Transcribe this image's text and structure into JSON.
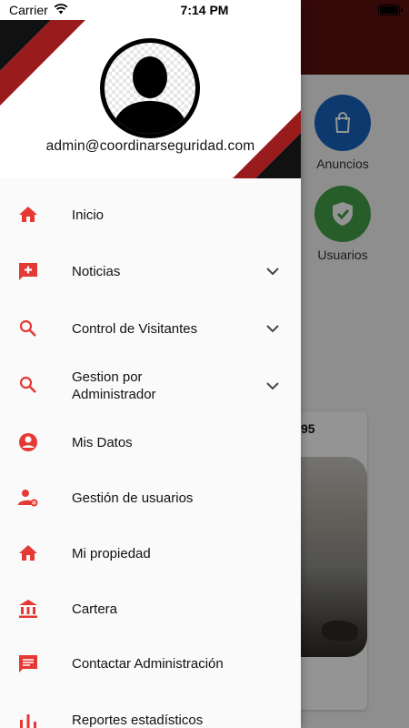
{
  "status_bar": {
    "carrier": "Carrier",
    "time": "7:14 PM"
  },
  "background": {
    "quick_actions": [
      {
        "label": "Anuncios",
        "icon": "shopping-bag-icon",
        "color": "#1565c0"
      },
      {
        "label": "Usuarios",
        "icon": "shield-check-icon",
        "color": "#43a047"
      }
    ],
    "card_number": "95"
  },
  "drawer": {
    "email": "admin@coordinarseguridad.com",
    "accent_color": "#e53935",
    "items": [
      {
        "label": "Inicio",
        "icon": "home-icon",
        "expandable": false
      },
      {
        "label": "Noticias",
        "icon": "add-comment-icon",
        "expandable": true
      },
      {
        "label": "Control de Visitantes",
        "icon": "search-icon",
        "expandable": true
      },
      {
        "label": "Gestion por\nAdministrador",
        "icon": "search-icon",
        "expandable": true
      },
      {
        "label": "Mis Datos",
        "icon": "account-circle-icon",
        "expandable": false
      },
      {
        "label": "Gestión de usuarios",
        "icon": "user-settings-icon",
        "expandable": false
      },
      {
        "label": "Mi propiedad",
        "icon": "home-icon",
        "expandable": false
      },
      {
        "label": "Cartera",
        "icon": "bank-icon",
        "expandable": false
      },
      {
        "label": "Contactar Administración",
        "icon": "message-icon",
        "expandable": false
      },
      {
        "label": "Reportes estadísticos",
        "icon": "bar-chart-icon",
        "expandable": false
      }
    ]
  }
}
